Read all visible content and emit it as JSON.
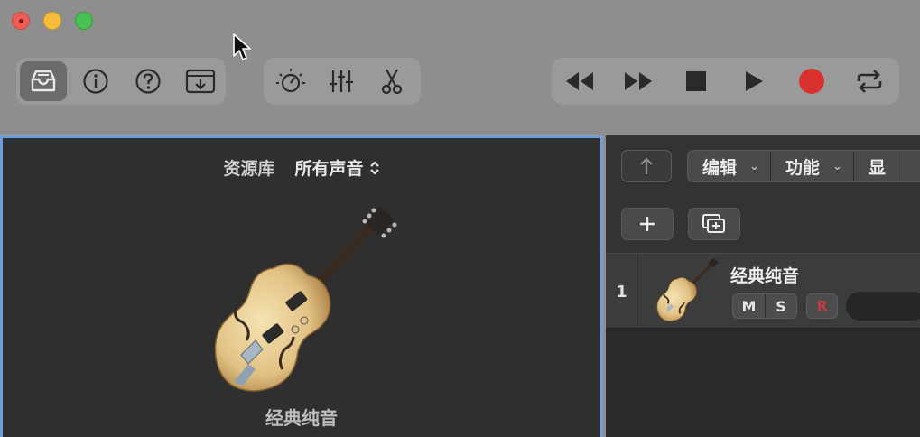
{
  "window": {
    "traffic_lights": [
      "close",
      "minimize",
      "zoom"
    ]
  },
  "toolbar": {
    "left_group": [
      {
        "name": "library-icon",
        "active": true
      },
      {
        "name": "info-icon",
        "active": false
      },
      {
        "name": "help-icon",
        "active": false
      },
      {
        "name": "download-icon",
        "active": false
      }
    ],
    "middle_group": [
      {
        "name": "smart-controls-icon"
      },
      {
        "name": "mixer-icon"
      },
      {
        "name": "scissors-icon"
      }
    ],
    "transport": [
      {
        "name": "rewind-icon"
      },
      {
        "name": "fast-forward-icon"
      },
      {
        "name": "stop-icon"
      },
      {
        "name": "play-icon"
      },
      {
        "name": "record-icon",
        "color": "#d9312d"
      },
      {
        "name": "cycle-icon"
      }
    ]
  },
  "library": {
    "title": "资源库",
    "filter": "所有声音",
    "patch_name": "经典纯音",
    "accent": "#6f9fd8"
  },
  "tracks_area": {
    "menu": [
      {
        "label": "编辑"
      },
      {
        "label": "功能"
      },
      {
        "label": "显"
      }
    ],
    "tracks": [
      {
        "number": "1",
        "name": "经典纯音",
        "mute": "M",
        "solo": "S",
        "record": "R"
      }
    ]
  }
}
